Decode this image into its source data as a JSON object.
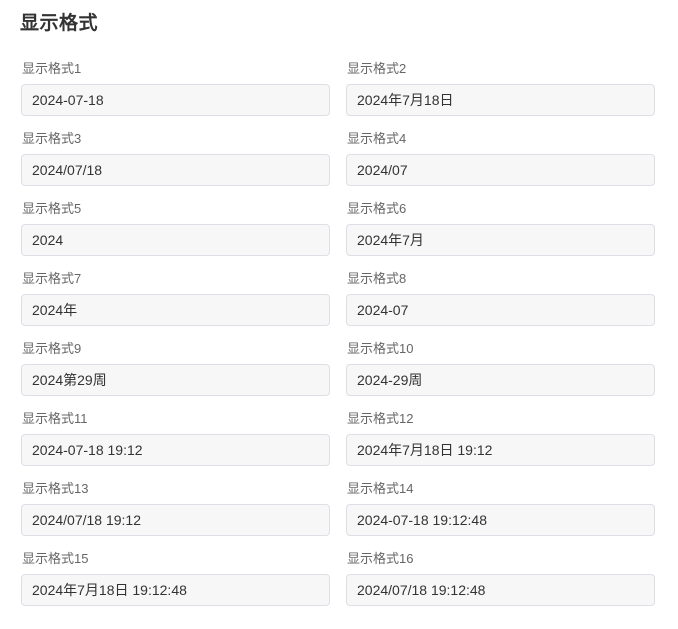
{
  "title": "显示格式",
  "fields": [
    {
      "label": "显示格式1",
      "value": "2024-07-18"
    },
    {
      "label": "显示格式2",
      "value": "2024年7月18日"
    },
    {
      "label": "显示格式3",
      "value": "2024/07/18"
    },
    {
      "label": "显示格式4",
      "value": "2024/07"
    },
    {
      "label": "显示格式5",
      "value": "2024"
    },
    {
      "label": "显示格式6",
      "value": "2024年7月"
    },
    {
      "label": "显示格式7",
      "value": "2024年"
    },
    {
      "label": "显示格式8",
      "value": "2024-07"
    },
    {
      "label": "显示格式9",
      "value": "2024第29周"
    },
    {
      "label": "显示格式10",
      "value": "2024-29周"
    },
    {
      "label": "显示格式11",
      "value": "2024-07-18 19:12"
    },
    {
      "label": "显示格式12",
      "value": "2024年7月18日 19:12"
    },
    {
      "label": "显示格式13",
      "value": "2024/07/18 19:12"
    },
    {
      "label": "显示格式14",
      "value": "2024-07-18 19:12:48"
    },
    {
      "label": "显示格式15",
      "value": "2024年7月18日 19:12:48"
    },
    {
      "label": "显示格式16",
      "value": "2024/07/18 19:12:48"
    }
  ]
}
